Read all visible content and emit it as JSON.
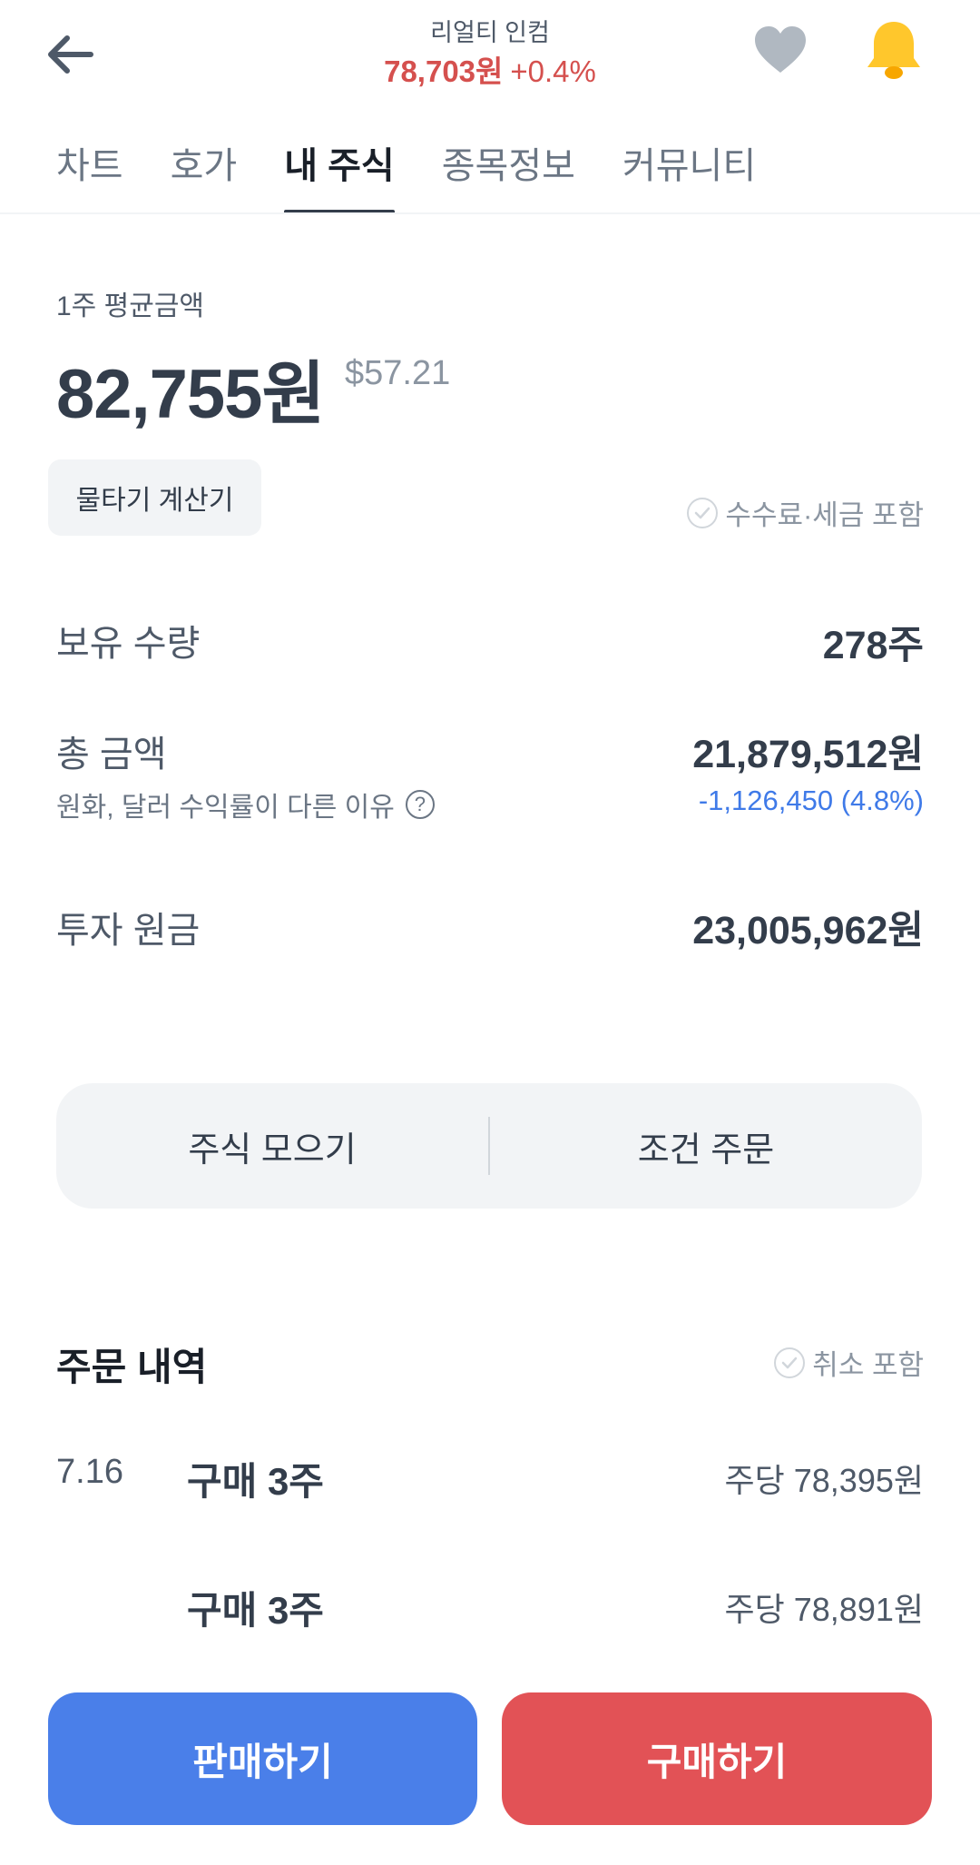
{
  "header": {
    "stock_name": "리얼티 인컴",
    "price": "78,703원",
    "change": "+0.4%",
    "icons": {
      "back": "arrow-left-icon",
      "favorite": "heart-icon",
      "alert": "bell-icon"
    }
  },
  "tabs": [
    {
      "label": "차트"
    },
    {
      "label": "호가"
    },
    {
      "label": "내 주식",
      "active": true
    },
    {
      "label": "종목정보"
    },
    {
      "label": "커뮤니티"
    }
  ],
  "summary": {
    "avg_label": "1주 평균금액",
    "avg_value": "82,755원",
    "avg_usd": "$57.21",
    "calculator_label": "물타기 계산기",
    "fee_label": "수수료·세금 포함"
  },
  "holdings": {
    "quantity_label": "보유 수량",
    "quantity_value": "278주",
    "total_label": "총 금액",
    "total_value": "21,879,512원",
    "fx_reason_label": "원화, 달러 수익률이 다른 이유",
    "profit_loss": "-1,126,450 (4.8%)",
    "principal_label": "투자 원금",
    "principal_value": "23,005,962원"
  },
  "actions": {
    "collect_label": "주식 모으기",
    "conditional_label": "조건 주문"
  },
  "orders": {
    "title": "주문 내역",
    "cancel_label": "취소 포함",
    "items": [
      {
        "date": "7.16",
        "desc": "구매 3주",
        "price": "주당 78,395원"
      },
      {
        "date": "",
        "desc": "구매 3주",
        "price": "주당 78,891원"
      }
    ]
  },
  "bottom": {
    "sell_label": "판매하기",
    "buy_label": "구매하기"
  },
  "colors": {
    "up_red": "#d5504e",
    "down_blue": "#3f7ae8",
    "sell_button": "#4a7fe9",
    "buy_button": "#e25256",
    "bell_yellow": "#ffc72c"
  }
}
